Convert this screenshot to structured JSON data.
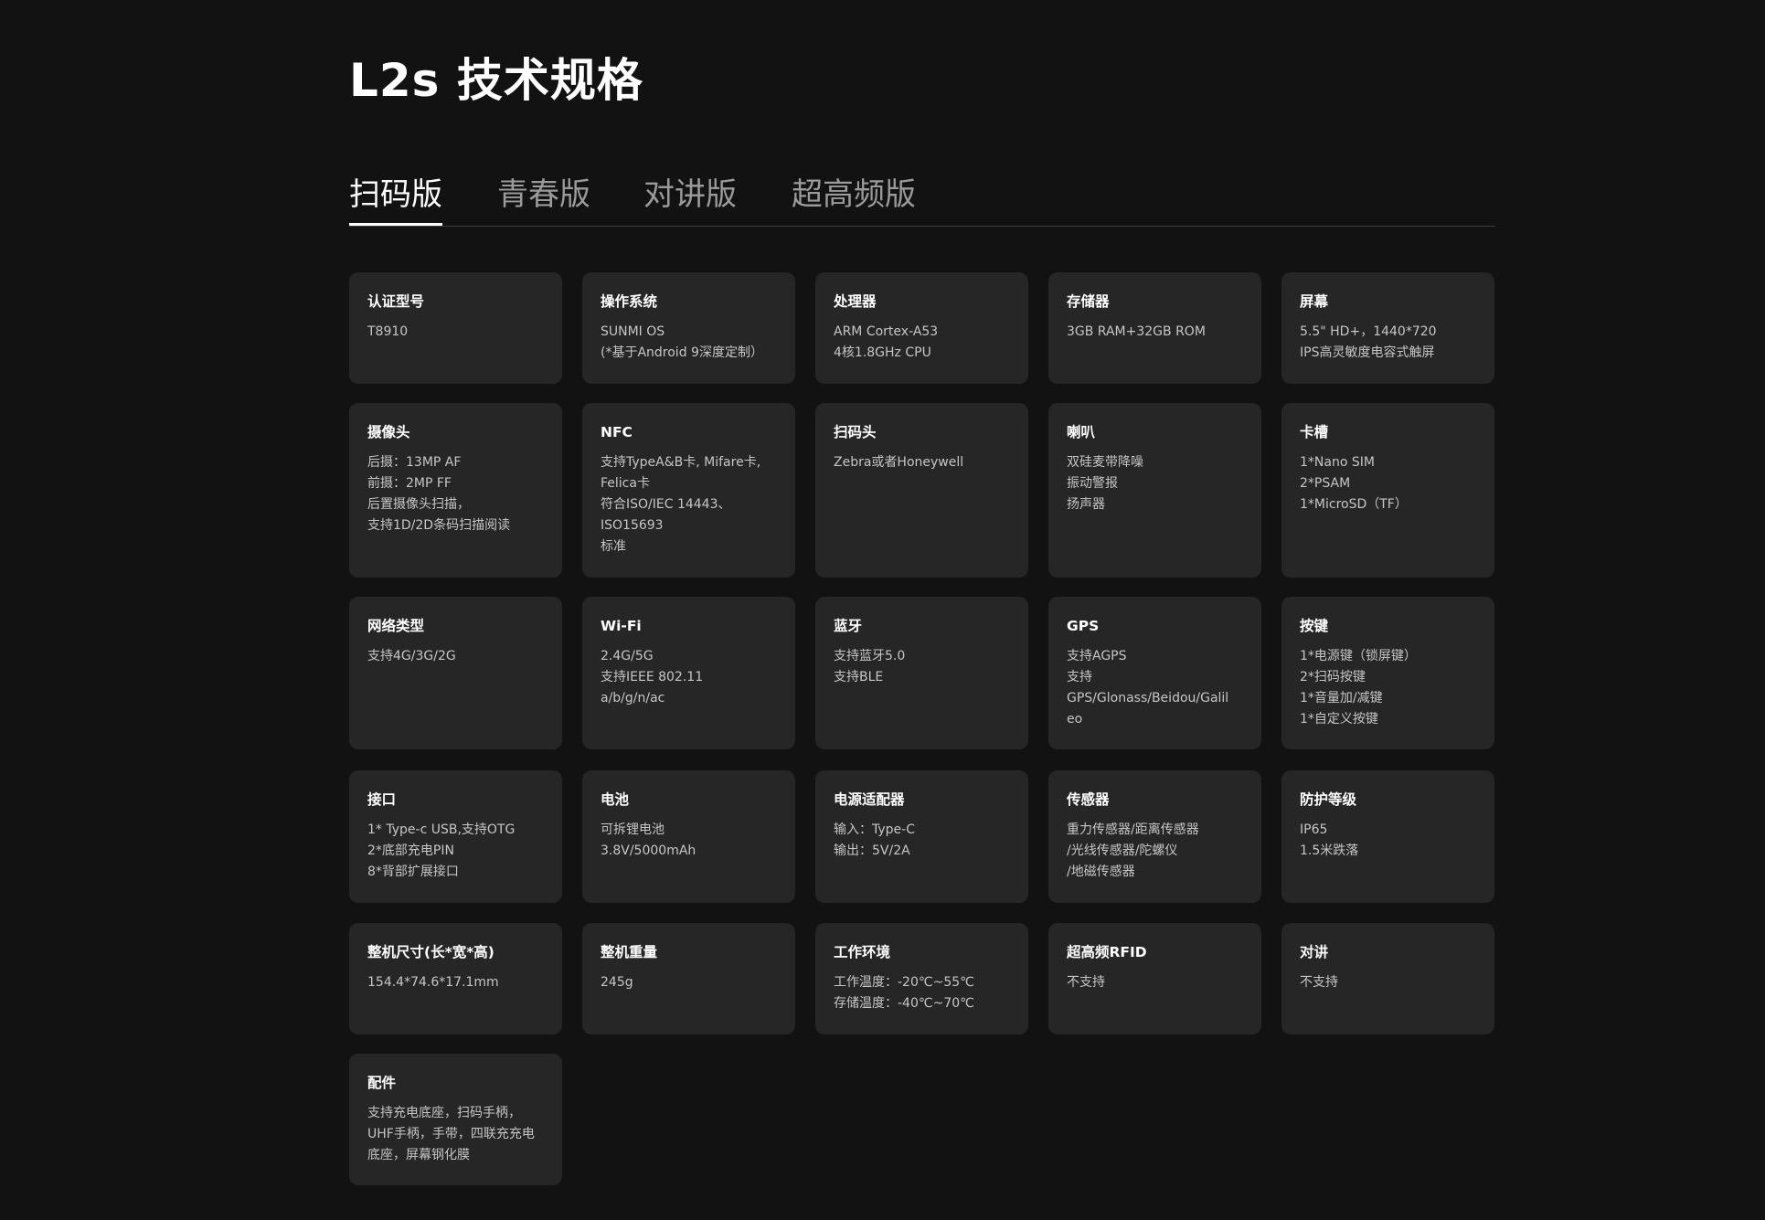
{
  "page": {
    "title": "L2s 技术规格"
  },
  "tabs": [
    "扫码版",
    "青春版",
    "对讲版",
    "超高频版"
  ],
  "active_tab": 0,
  "specs": [
    {
      "title": "认证型号",
      "lines": [
        "T8910"
      ]
    },
    {
      "title": "操作系统",
      "lines": [
        "SUNMI OS",
        "(*基于Android 9深度定制）"
      ]
    },
    {
      "title": "处理器",
      "lines": [
        "ARM Cortex-A53",
        "4核1.8GHz CPU"
      ]
    },
    {
      "title": "存储器",
      "lines": [
        "3GB RAM+32GB ROM"
      ]
    },
    {
      "title": "屏幕",
      "lines": [
        "5.5\" HD+，1440*720",
        "IPS高灵敏度电容式触屏"
      ]
    },
    {
      "title": "摄像头",
      "lines": [
        "后摄：13MP AF",
        "前摄：2MP FF",
        "后置摄像头扫描，",
        "支持1D/2D条码扫描阅读"
      ]
    },
    {
      "title": "NFC",
      "lines": [
        "支持TypeA&B卡, Mifare卡,",
        "Felica卡",
        "符合ISO/IEC 14443、",
        "ISO15693",
        "标准"
      ]
    },
    {
      "title": "扫码头",
      "lines": [
        "Zebra或者Honeywell"
      ]
    },
    {
      "title": "喇叭",
      "lines": [
        "双硅麦带降噪",
        "振动警报",
        "扬声器"
      ]
    },
    {
      "title": "卡槽",
      "lines": [
        "1*Nano SIM",
        "2*PSAM",
        "1*MicroSD（TF）"
      ]
    },
    {
      "title": "网络类型",
      "lines": [
        "支持4G/3G/2G"
      ]
    },
    {
      "title": "Wi-Fi",
      "lines": [
        "2.4G/5G",
        "支持IEEE 802.11",
        "a/b/g/n/ac"
      ]
    },
    {
      "title": "蓝牙",
      "lines": [
        "支持蓝牙5.0",
        "支持BLE"
      ]
    },
    {
      "title": "GPS",
      "lines": [
        "支持AGPS",
        "支持",
        "GPS/Glonass/Beidou/Galil",
        "eo"
      ]
    },
    {
      "title": "按键",
      "lines": [
        "1*电源键（锁屏键）",
        "2*扫码按键",
        "1*音量加/减键",
        "1*自定义按键"
      ]
    },
    {
      "title": "接口",
      "lines": [
        "1* Type-c USB,支持OTG",
        "2*底部充电PIN",
        "8*背部扩展接口"
      ]
    },
    {
      "title": "电池",
      "lines": [
        "可拆锂电池",
        "3.8V/5000mAh"
      ]
    },
    {
      "title": "电源适配器",
      "lines": [
        "输入：Type-C",
        "输出：5V/2A"
      ]
    },
    {
      "title": "传感器",
      "lines": [
        "重力传感器/距离传感器",
        "/光线传感器/陀螺仪",
        "/地磁传感器"
      ]
    },
    {
      "title": "防护等级",
      "lines": [
        "IP65",
        "1.5米跌落"
      ]
    },
    {
      "title": "整机尺寸(长*宽*高)",
      "lines": [
        "154.4*74.6*17.1mm"
      ]
    },
    {
      "title": "整机重量",
      "lines": [
        "245g"
      ]
    },
    {
      "title": "工作环境",
      "lines": [
        "工作温度：-20℃~55℃",
        "存储温度：-40℃~70℃"
      ]
    },
    {
      "title": "超高频RFID",
      "lines": [
        "不支持"
      ]
    },
    {
      "title": "对讲",
      "lines": [
        "不支持"
      ]
    },
    {
      "title": "配件",
      "lines": [
        "支持充电底座，扫码手柄，",
        "UHF手柄，手带，四联充充电",
        "底座，屏幕钢化膜"
      ]
    }
  ]
}
